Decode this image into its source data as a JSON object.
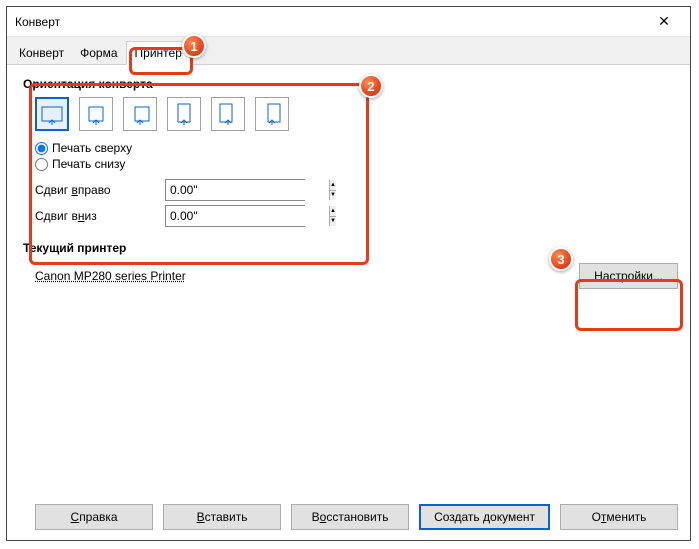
{
  "window": {
    "title": "Конверт"
  },
  "tabs": {
    "envelope": "Конверт",
    "format": "Форма",
    "printer": "Принтер"
  },
  "orientation": {
    "title": "Ориентация конверта",
    "print_top": "Печать сверху",
    "print_bottom": "Печать снизу",
    "shift_right_label": "Сдвиг вправо",
    "shift_down_label": "Сдвиг вниз",
    "shift_right_value": "0.00\"",
    "shift_down_value": "0.00\""
  },
  "printer": {
    "title": "Текущий принтер",
    "name": "Canon MP280 series Printer",
    "settings_btn": "Настройки..."
  },
  "footer": {
    "help": "Справка",
    "insert": "Вставить",
    "restore": "Восстановить",
    "create": "Создать документ",
    "cancel": "Отменить"
  },
  "badges": {
    "b1": "1",
    "b2": "2",
    "b3": "3"
  }
}
